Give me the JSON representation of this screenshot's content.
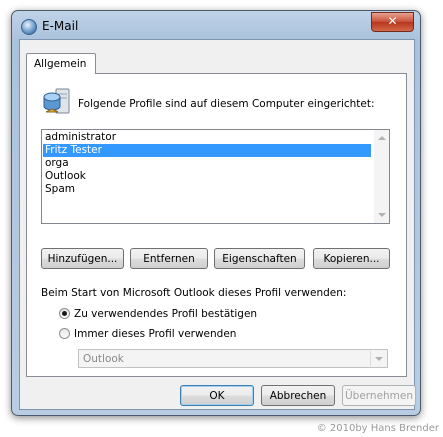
{
  "window": {
    "title": "E-Mail",
    "close_symbol": "✕"
  },
  "tabs": [
    {
      "label": "Allgemein",
      "active": true
    }
  ],
  "profiles": {
    "intro_text": "Folgende Profile sind auf diesem Computer eingerichtet:",
    "items": [
      "administrator",
      "Fritz Tester",
      "orga",
      "Outlook",
      "Spam"
    ],
    "selected_item": "Fritz Tester"
  },
  "buttons": {
    "add": "Hinzufügen...",
    "remove": "Entfernen",
    "properties": "Eigenschaften",
    "copy": "Kopieren..."
  },
  "startup": {
    "label": "Beim Start von Microsoft Outlook dieses Profil verwenden:",
    "option_confirm": "Zu verwendendes Profil bestätigen",
    "option_always": "Immer dieses Profil verwenden",
    "selected_option": "confirm",
    "profile_combo_value": "Outlook"
  },
  "footer": {
    "ok": "OK",
    "cancel": "Abbrechen",
    "apply": "Übernehmen"
  },
  "watermark": "© 2010by Hans Brender",
  "colors": {
    "selection": "#3399ff",
    "close_button": "#c84e36",
    "window_frame": "#aac2dc"
  }
}
